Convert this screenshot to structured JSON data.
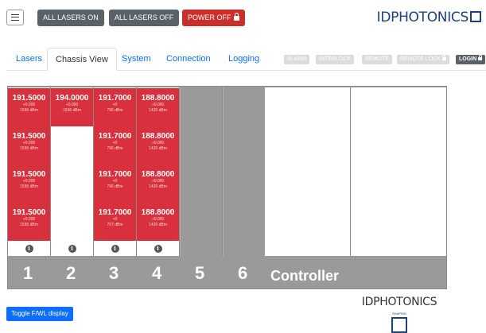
{
  "header": {
    "menu_icon": "hamburger-icon",
    "all_on": "ALL LASERS ON",
    "all_off": "ALL LASERS OFF",
    "power_off": "POWER OFF",
    "logo": "IDPHOTONICS"
  },
  "tabs": [
    {
      "label": "Lasers",
      "active": false
    },
    {
      "label": "Chassis View",
      "active": true
    },
    {
      "label": "System",
      "active": false
    },
    {
      "label": "Connection",
      "active": false
    },
    {
      "label": "Logging",
      "active": false
    }
  ],
  "status": {
    "alarm": "ALARM",
    "interlock": "INTERLOCK",
    "remote": "REMOTE",
    "remote_lock": "REMOTE LOCK",
    "login": "LOGIN"
  },
  "chassis": {
    "slots": [
      {
        "number": "1",
        "cells": [
          {
            "freq": "191.5000",
            "l1": "+0.000",
            "l2": "1536 dBm"
          },
          {
            "freq": "191.5000",
            "l1": "+0.000",
            "l2": "1536 dBm"
          },
          {
            "freq": "191.5000",
            "l1": "+0.000",
            "l2": "1536 dBm"
          },
          {
            "freq": "191.5000",
            "l1": "+0.000",
            "l2": "1536 dBm"
          }
        ]
      },
      {
        "number": "2",
        "cells": [
          {
            "freq": "194.0000",
            "l1": "+0.000",
            "l2": "1536 dBm"
          }
        ]
      },
      {
        "number": "3",
        "cells": [
          {
            "freq": "191.7000",
            "l1": "+0",
            "l2": "796 dBm"
          },
          {
            "freq": "191.7000",
            "l1": "+0",
            "l2": "796 dBm"
          },
          {
            "freq": "191.7000",
            "l1": "+0",
            "l2": "796 dBm"
          },
          {
            "freq": "191.7000",
            "l1": "+0",
            "l2": "797 dBm"
          }
        ]
      },
      {
        "number": "4",
        "cells": [
          {
            "freq": "188.8000",
            "l1": "+0.000",
            "l2": "1435 dBm"
          },
          {
            "freq": "188.8000",
            "l1": "+0.000",
            "l2": "1435 dBm"
          },
          {
            "freq": "188.8000",
            "l1": "+0.000",
            "l2": "1435 dBm"
          },
          {
            "freq": "188.8000",
            "l1": "+0.000",
            "l2": "1435 dBm"
          }
        ]
      },
      {
        "number": "5",
        "cells": []
      },
      {
        "number": "6",
        "cells": []
      }
    ],
    "controller_label": "Controller",
    "controller_logo": "IDPHOTONICS",
    "controller_tagline": "SHAPING"
  },
  "toggle_label": "Toggle F/WL display"
}
